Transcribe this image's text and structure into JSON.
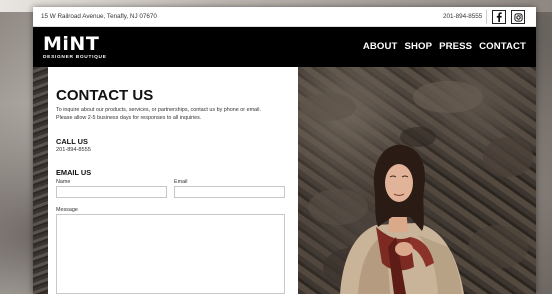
{
  "topbar": {
    "address": "15 W Railroad Avenue, Tenafly, NJ 07670",
    "phone": "201-894-8555",
    "social": [
      "facebook-icon",
      "instagram-icon"
    ]
  },
  "header": {
    "logo_main": "MiNT",
    "logo_sub": "DESIGNER BOUTIQUE",
    "nav": [
      {
        "label": "ABOUT"
      },
      {
        "label": "SHOP"
      },
      {
        "label": "PRESS"
      },
      {
        "label": "CONTACT"
      }
    ]
  },
  "contact": {
    "title": "CONTACT US",
    "intro_line1": "To inquire about our products, services, or partnerships, contact us by phone or email.",
    "intro_line2": "Please allow 2-5 business days for responses to all inquiries.",
    "call_heading": "CALL US",
    "call_number": "201-894-8555",
    "email_heading": "EMAIL US",
    "form": {
      "name_label": "Name",
      "name_value": "",
      "email_label": "Email",
      "email_value": "",
      "message_label": "Message",
      "message_value": ""
    }
  },
  "colors": {
    "navbar": "#000000",
    "text": "#111111"
  }
}
